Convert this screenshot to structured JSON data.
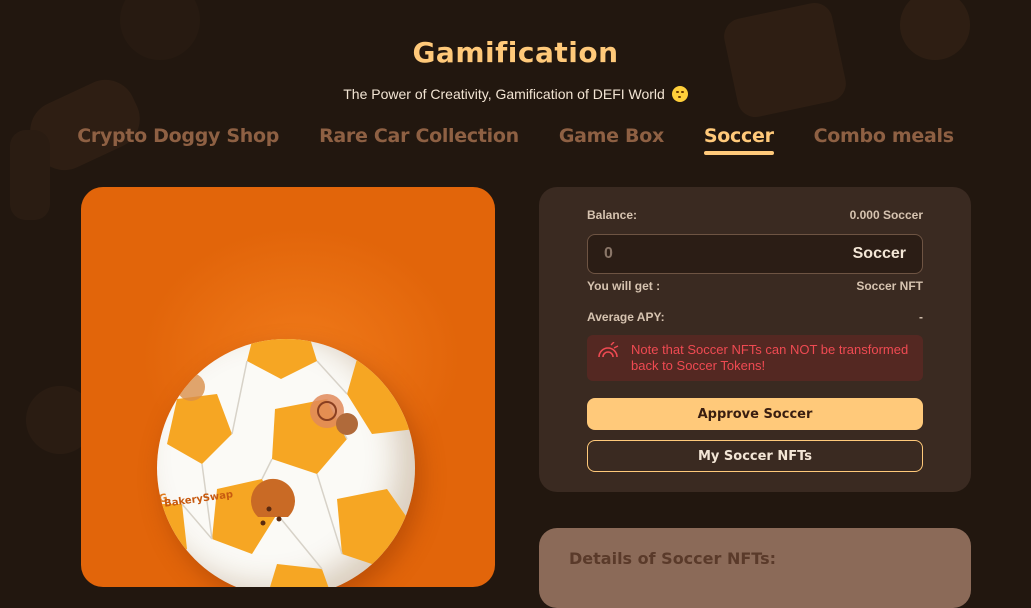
{
  "header": {
    "title": "Gamification",
    "subtitle": "The Power of Creativity, Gamification of DEFI World"
  },
  "tabs": [
    {
      "label": "Crypto Doggy Shop",
      "active": false
    },
    {
      "label": "Rare Car Collection",
      "active": false
    },
    {
      "label": "Game Box",
      "active": false
    },
    {
      "label": "Soccer",
      "active": true
    },
    {
      "label": "Combo meals",
      "active": false
    }
  ],
  "image": {
    "ball_logo_text": "BakerySwap"
  },
  "form": {
    "balance_label": "Balance:",
    "balance_value": "0.000 Soccer",
    "amount_placeholder": "0",
    "amount_unit": "Soccer",
    "you_get_label": "You will get :",
    "you_get_value": "Soccer NFT",
    "apy_label": "Average APY:",
    "apy_value": "-",
    "warning_text": "Note that Soccer NFTs can NOT be transformed back to Soccer Tokens!",
    "approve_button": "Approve Soccer",
    "my_nfts_button": "My Soccer NFTs"
  },
  "details": {
    "title": "Details of Soccer NFTs:"
  },
  "icons": {
    "warning": "rainbow-warning-icon",
    "emoji": "yum-face-emoji-icon"
  },
  "colors": {
    "background": "#22170f",
    "accent": "#ffc97a",
    "tab_inactive": "#8e6043",
    "card": "#3a2a21",
    "warning_bg": "#542822",
    "warning_text": "#ef4a52",
    "image_bg": "#e2650a"
  }
}
